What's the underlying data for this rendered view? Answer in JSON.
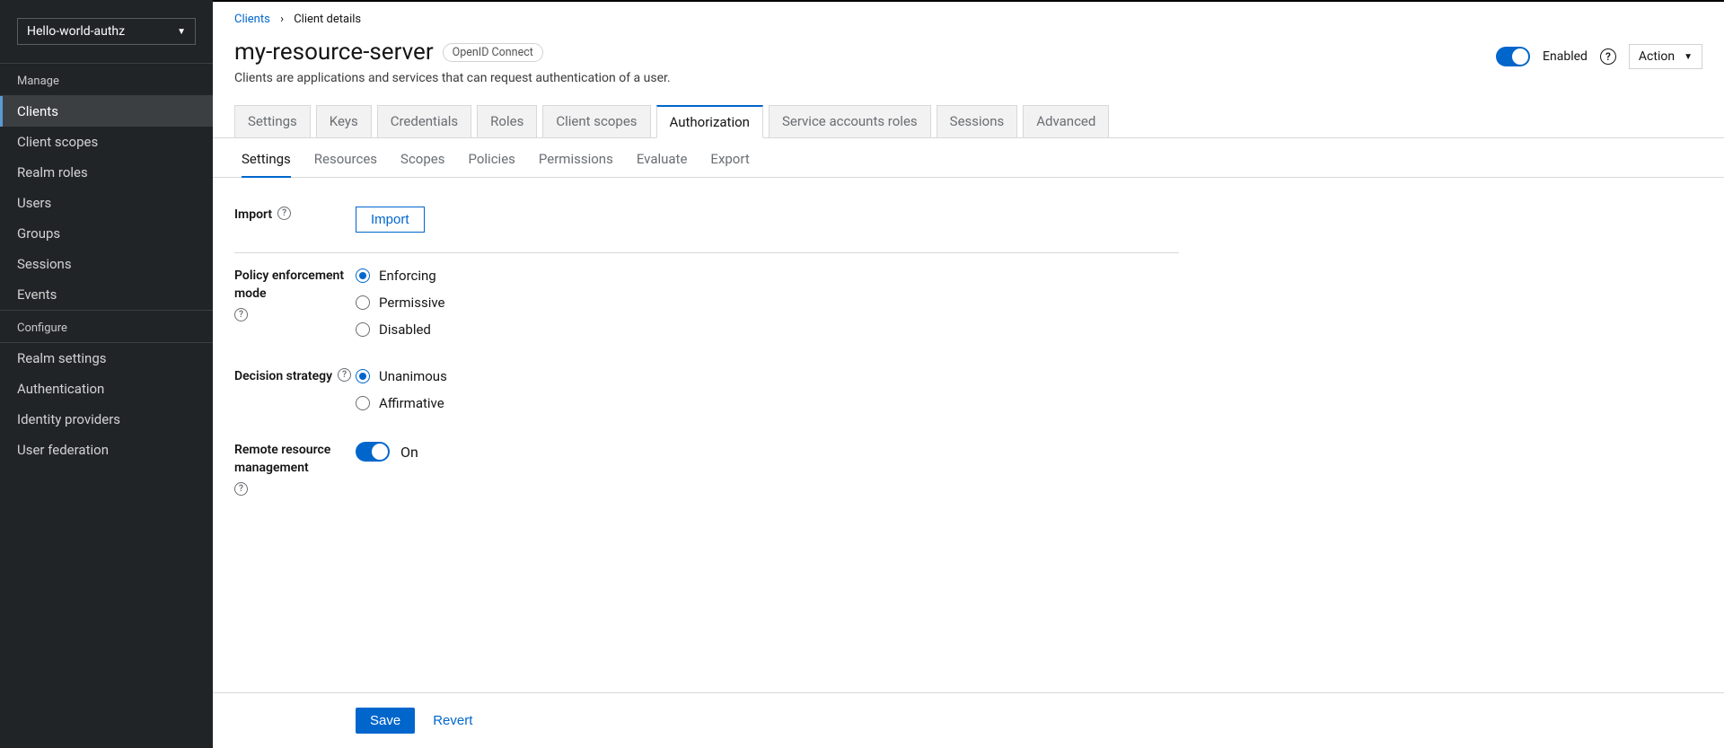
{
  "sidebar": {
    "realm": "Hello-world-authz",
    "sections": [
      {
        "label": "Manage",
        "items": [
          {
            "label": "Clients",
            "active": true
          },
          {
            "label": "Client scopes"
          },
          {
            "label": "Realm roles"
          },
          {
            "label": "Users"
          },
          {
            "label": "Groups"
          },
          {
            "label": "Sessions"
          },
          {
            "label": "Events"
          }
        ]
      },
      {
        "label": "Configure",
        "items": [
          {
            "label": "Realm settings"
          },
          {
            "label": "Authentication"
          },
          {
            "label": "Identity providers"
          },
          {
            "label": "User federation"
          }
        ]
      }
    ]
  },
  "breadcrumb": {
    "root": "Clients",
    "current": "Client details"
  },
  "header": {
    "title": "my-resource-server",
    "badge": "OpenID Connect",
    "subtitle": "Clients are applications and services that can request authentication of a user.",
    "enabled_label": "Enabled",
    "action_label": "Action"
  },
  "primary_tabs": [
    "Settings",
    "Keys",
    "Credentials",
    "Roles",
    "Client scopes",
    "Authorization",
    "Service accounts roles",
    "Sessions",
    "Advanced"
  ],
  "primary_tab_active": "Authorization",
  "sub_tabs": [
    "Settings",
    "Resources",
    "Scopes",
    "Policies",
    "Permissions",
    "Evaluate",
    "Export"
  ],
  "sub_tab_active": "Settings",
  "form": {
    "import": {
      "label": "Import",
      "button": "Import"
    },
    "policy_mode": {
      "label": "Policy enforcement mode",
      "options": [
        "Enforcing",
        "Permissive",
        "Disabled"
      ],
      "selected": "Enforcing"
    },
    "decision_strategy": {
      "label": "Decision strategy",
      "options": [
        "Unanimous",
        "Affirmative"
      ],
      "selected": "Unanimous"
    },
    "remote_resource": {
      "label": "Remote resource management",
      "state_label": "On"
    }
  },
  "footer": {
    "save": "Save",
    "revert": "Revert"
  }
}
